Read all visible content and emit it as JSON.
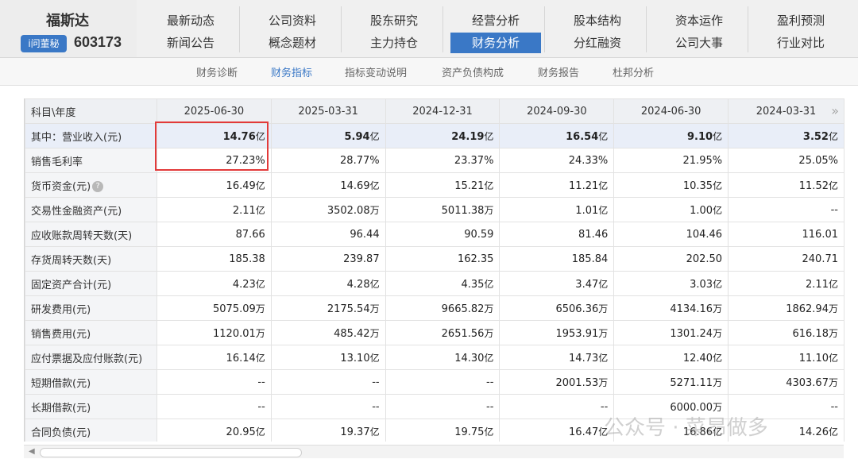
{
  "brand": {
    "name": "福斯达",
    "badge": "i问董秘",
    "code": "603173"
  },
  "nav": [
    {
      "top": "最新动态",
      "bottom": "新闻公告"
    },
    {
      "top": "公司资料",
      "bottom": "概念题材"
    },
    {
      "top": "股东研究",
      "bottom": "主力持仓"
    },
    {
      "top": "经营分析",
      "bottom": "财务分析"
    },
    {
      "top": "股本结构",
      "bottom": "分红融资"
    },
    {
      "top": "资本运作",
      "bottom": "公司大事"
    },
    {
      "top": "盈利预测",
      "bottom": "行业对比"
    }
  ],
  "subnav": [
    "财务诊断",
    "财务指标",
    "指标变动说明",
    "资产负债构成",
    "财务报告",
    "杜邦分析"
  ],
  "table": {
    "header": [
      "科目\\年度",
      "2025-06-30",
      "2025-03-31",
      "2024-12-31",
      "2024-09-30",
      "2024-06-30",
      "2024-03-31"
    ],
    "rows": [
      {
        "label": "其中：营业收入(元)",
        "cells": [
          [
            "14.76",
            "亿"
          ],
          [
            "5.94",
            "亿"
          ],
          [
            "24.19",
            "亿"
          ],
          [
            "16.54",
            "亿"
          ],
          [
            "9.10",
            "亿"
          ],
          [
            "3.52",
            "亿"
          ]
        ]
      },
      {
        "label": "销售毛利率",
        "cells": [
          [
            "27.23%",
            ""
          ],
          [
            "28.77%",
            ""
          ],
          [
            "23.37%",
            ""
          ],
          [
            "24.33%",
            ""
          ],
          [
            "21.95%",
            ""
          ],
          [
            "25.05%",
            ""
          ]
        ]
      },
      {
        "label": "货币资金(元)",
        "cells": [
          [
            "16.49",
            "亿"
          ],
          [
            "14.69",
            "亿"
          ],
          [
            "15.21",
            "亿"
          ],
          [
            "11.21",
            "亿"
          ],
          [
            "10.35",
            "亿"
          ],
          [
            "11.52",
            "亿"
          ]
        ]
      },
      {
        "label": "交易性金融资产(元)",
        "cells": [
          [
            "2.11",
            "亿"
          ],
          [
            "3502.08",
            "万"
          ],
          [
            "5011.38",
            "万"
          ],
          [
            "1.01",
            "亿"
          ],
          [
            "1.00",
            "亿"
          ],
          [
            "--",
            ""
          ]
        ]
      },
      {
        "label": "应收账款周转天数(天)",
        "cells": [
          [
            "87.66",
            ""
          ],
          [
            "96.44",
            ""
          ],
          [
            "90.59",
            ""
          ],
          [
            "81.46",
            ""
          ],
          [
            "104.46",
            ""
          ],
          [
            "116.01",
            ""
          ]
        ]
      },
      {
        "label": "存货周转天数(天)",
        "cells": [
          [
            "185.38",
            ""
          ],
          [
            "239.87",
            ""
          ],
          [
            "162.35",
            ""
          ],
          [
            "185.84",
            ""
          ],
          [
            "202.50",
            ""
          ],
          [
            "240.71",
            ""
          ]
        ]
      },
      {
        "label": "固定资产合计(元)",
        "cells": [
          [
            "4.23",
            "亿"
          ],
          [
            "4.28",
            "亿"
          ],
          [
            "4.35",
            "亿"
          ],
          [
            "3.47",
            "亿"
          ],
          [
            "3.03",
            "亿"
          ],
          [
            "2.11",
            "亿"
          ]
        ]
      },
      {
        "label": "研发费用(元)",
        "cells": [
          [
            "5075.09",
            "万"
          ],
          [
            "2175.54",
            "万"
          ],
          [
            "9665.82",
            "万"
          ],
          [
            "6506.36",
            "万"
          ],
          [
            "4134.16",
            "万"
          ],
          [
            "1862.94",
            "万"
          ]
        ]
      },
      {
        "label": "销售费用(元)",
        "cells": [
          [
            "1120.01",
            "万"
          ],
          [
            "485.42",
            "万"
          ],
          [
            "2651.56",
            "万"
          ],
          [
            "1953.91",
            "万"
          ],
          [
            "1301.24",
            "万"
          ],
          [
            "616.18",
            "万"
          ]
        ]
      },
      {
        "label": "应付票据及应付账款(元)",
        "cells": [
          [
            "16.14",
            "亿"
          ],
          [
            "13.10",
            "亿"
          ],
          [
            "14.30",
            "亿"
          ],
          [
            "14.73",
            "亿"
          ],
          [
            "12.40",
            "亿"
          ],
          [
            "11.10",
            "亿"
          ]
        ]
      },
      {
        "label": "短期借款(元)",
        "cells": [
          [
            "--",
            ""
          ],
          [
            "--",
            ""
          ],
          [
            "--",
            ""
          ],
          [
            "2001.53",
            "万"
          ],
          [
            "5271.11",
            "万"
          ],
          [
            "4303.67",
            "万"
          ]
        ]
      },
      {
        "label": "长期借款(元)",
        "cells": [
          [
            "--",
            ""
          ],
          [
            "--",
            ""
          ],
          [
            "--",
            ""
          ],
          [
            "--",
            ""
          ],
          [
            "6000.00",
            "万"
          ],
          [
            "--",
            ""
          ]
        ]
      },
      {
        "label": "合同负债(元)",
        "cells": [
          [
            "20.95",
            "亿"
          ],
          [
            "19.37",
            "亿"
          ],
          [
            "19.75",
            "亿"
          ],
          [
            "16.47",
            "亿"
          ],
          [
            "16.86",
            "亿"
          ],
          [
            "14.26",
            "亿"
          ]
        ]
      }
    ]
  },
  "icons": {
    "more": "double-chevron-right-icon",
    "help": "question-circle-icon"
  },
  "watermark": "公众号 · 菜昂做多",
  "colors": {
    "accent": "#3a78c6",
    "highlight_box": "#e23a3a"
  }
}
